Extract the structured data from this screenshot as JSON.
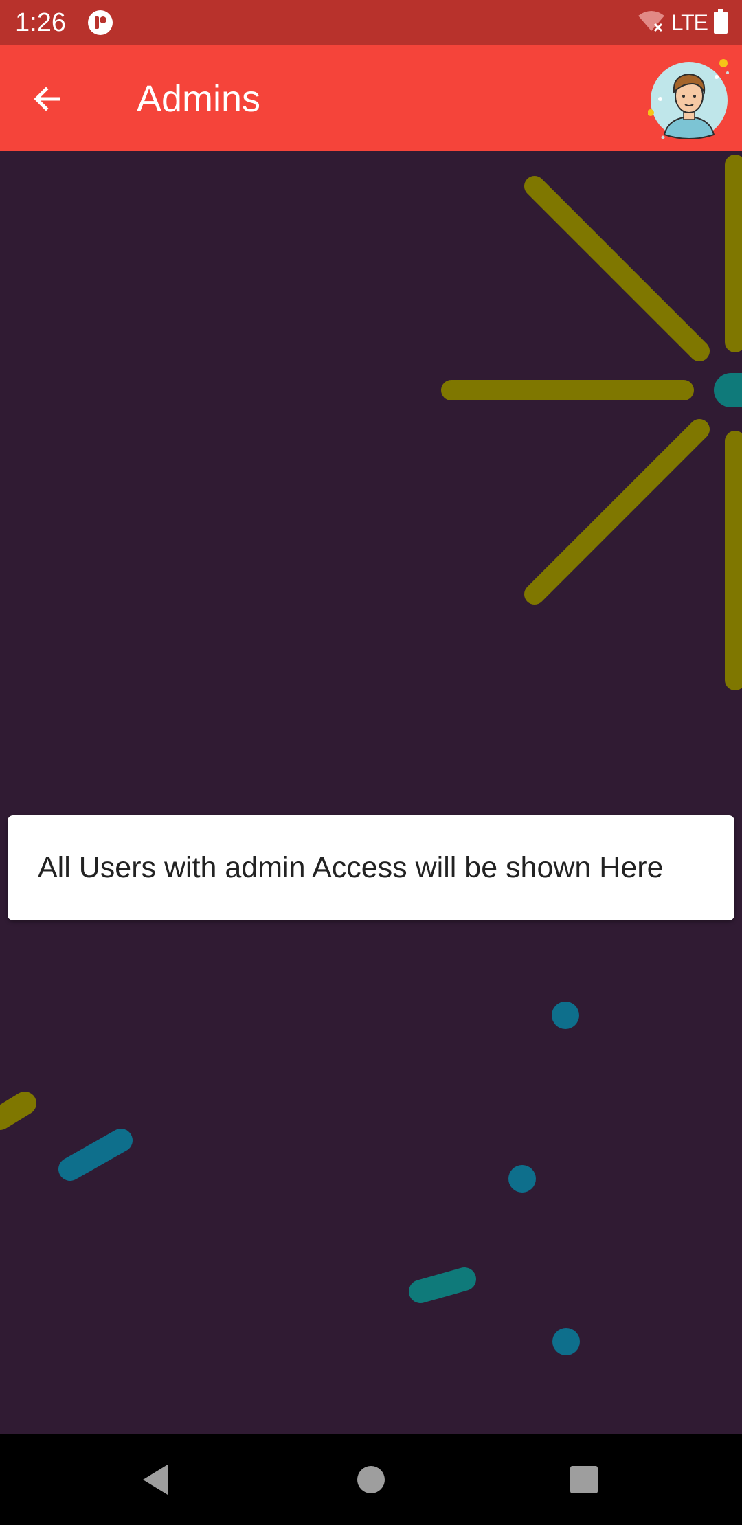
{
  "status_bar": {
    "time": "1:26",
    "network": "LTE",
    "icons": [
      "app-notification-icon",
      "wifi-off-icon",
      "battery-icon"
    ]
  },
  "app_bar": {
    "title": "Admins",
    "back_icon": "arrow-back-icon",
    "avatar_icon": "user-avatar"
  },
  "content": {
    "message": "All Users with admin Access will be shown Here"
  },
  "nav_bar": {
    "icons": [
      "back-triangle-icon",
      "home-circle-icon",
      "recents-square-icon"
    ]
  },
  "colors": {
    "status_bar": "#b8322c",
    "app_bar": "#f5443a",
    "background": "#301b33",
    "firework_yellow": "#7f7700",
    "firework_teal": "#0f7a7a",
    "firework_blue": "#0e6f8c",
    "card": "#ffffff"
  }
}
